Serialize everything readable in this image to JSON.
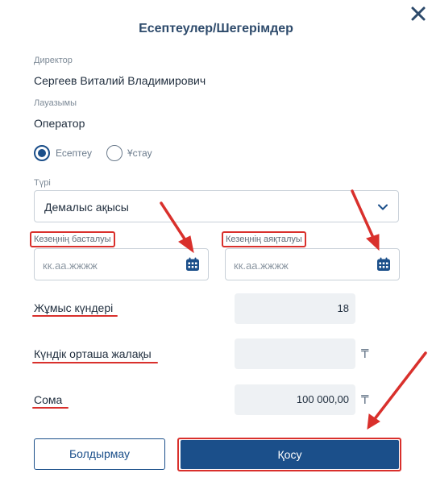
{
  "dialog": {
    "title": "Есептеулер/Шегерімдер",
    "close_icon": "close-icon"
  },
  "director": {
    "label": "Директор",
    "value": "Сергеев Виталий Владимирович"
  },
  "position": {
    "label": "Лауазымы",
    "value": "Оператор"
  },
  "radio": {
    "options": [
      {
        "label": "Есептеу",
        "checked": true
      },
      {
        "label": "Ұстау",
        "checked": false
      }
    ]
  },
  "type_select": {
    "label": "Түрі",
    "value": "Демалыс ақысы",
    "icon": "chevron-down-icon"
  },
  "period_start": {
    "label": "Кезеңнің басталуы",
    "placeholder": "кк.аа.жжжж",
    "icon": "calendar-icon"
  },
  "period_end": {
    "label": "Кезеңнің аяқталуы",
    "placeholder": "кк.аа.жжжж",
    "icon": "calendar-icon"
  },
  "work_days": {
    "label": "Жұмыс күндері",
    "value": "18"
  },
  "avg_daily_salary": {
    "label": "Күндік орташа жалақы",
    "value": "",
    "currency": "₸"
  },
  "amount": {
    "label": "Сома",
    "value": "100 000,00",
    "currency": "₸"
  },
  "buttons": {
    "cancel": "Болдырмау",
    "add": "Қосу"
  },
  "colors": {
    "accent": "#1b4f8a",
    "annotation": "#d9302c",
    "title": "#2d4a6b"
  }
}
